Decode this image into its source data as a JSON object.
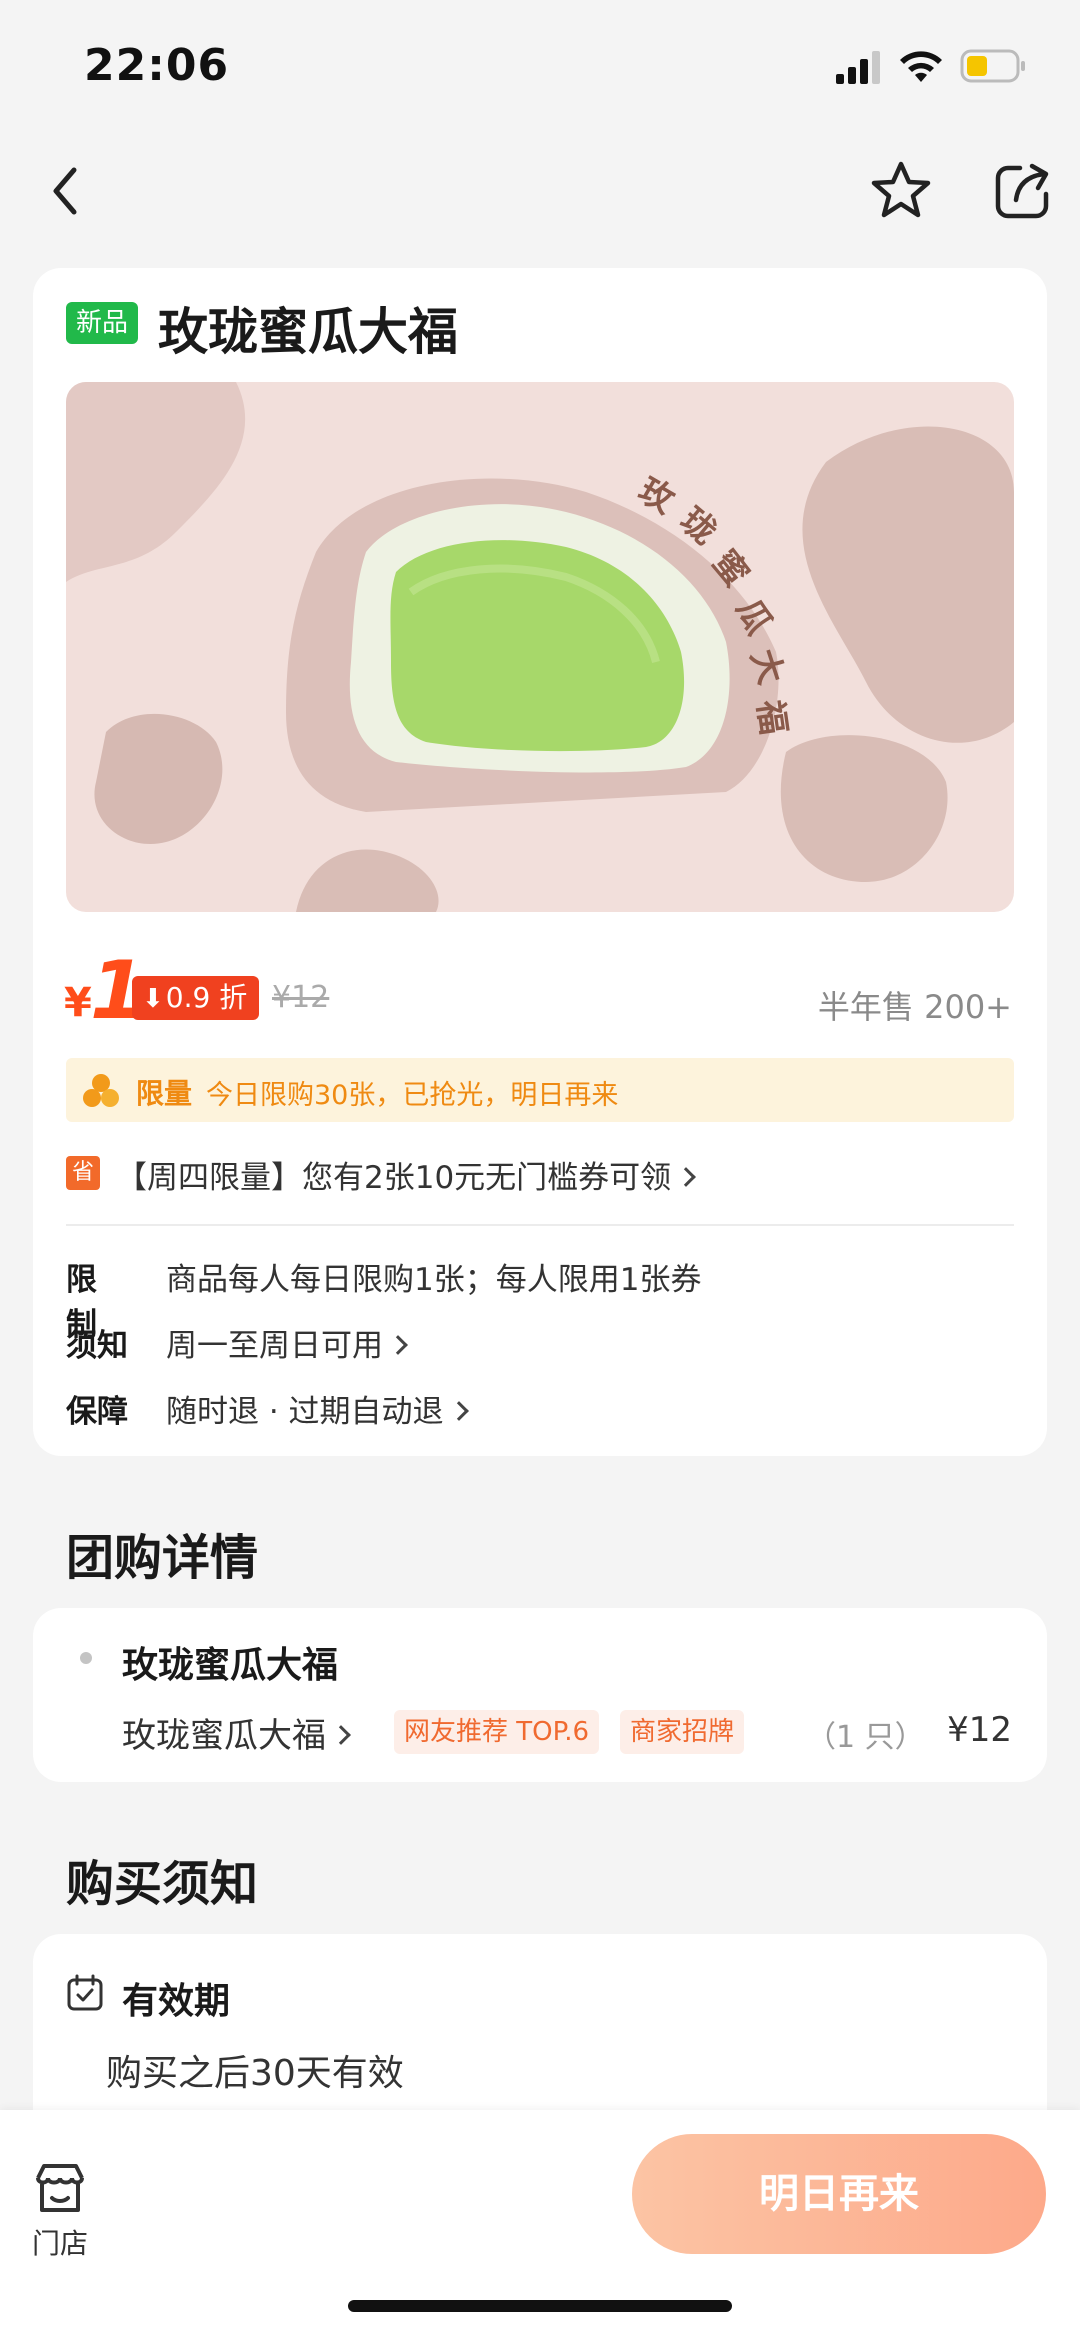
{
  "status_bar": {
    "time": "22:06"
  },
  "product": {
    "badge": "新品",
    "title": "玫珑蜜瓜大福",
    "image_caption": "玫珑蜜瓜大福",
    "price_symbol": "¥",
    "price": "1",
    "discount": "0.9 折",
    "original_price": "¥12",
    "sold": "半年售 200+"
  },
  "limit": {
    "tag": "限量",
    "text": "今日限购30张，已抢光，明日再来"
  },
  "coupon": {
    "icon": "省",
    "text": "【周四限量】您有2张10元无门槛券可领"
  },
  "rules": [
    {
      "label": "限制",
      "text": "商品每人每日限购1张；每人限用1张券"
    },
    {
      "label": "须知",
      "text": "周一至周日可用"
    },
    {
      "label": "保障",
      "text": "随时退 · 过期自动退"
    }
  ],
  "group_section": {
    "title": "团购详情",
    "name": "玫珑蜜瓜大福",
    "item": "玫珑蜜瓜大福",
    "tags": [
      "网友推荐 TOP.6",
      "商家招牌"
    ],
    "qty": "（1 只）",
    "price": "¥12"
  },
  "notice_section": {
    "title": "购买须知",
    "head": "有效期",
    "text": "购买之后30天有效"
  },
  "bottom": {
    "store_label": "门店",
    "cta": "明日再来"
  },
  "colors": {
    "accent": "#ff4d1a",
    "badge_green": "#21b94a",
    "limit_orange": "#ef8a12",
    "cta_start": "#fcc4a4",
    "cta_end": "#fda98a"
  }
}
